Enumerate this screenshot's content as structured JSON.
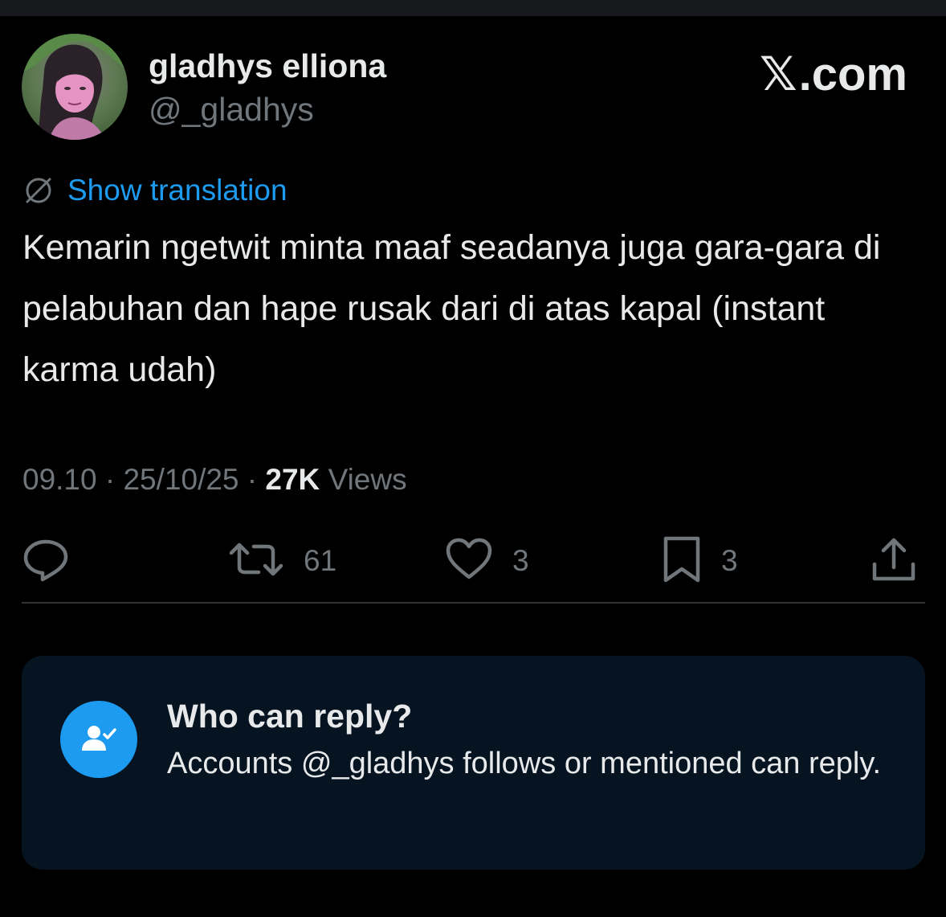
{
  "user": {
    "display_name": "gladhys elliona",
    "handle": "@_gladhys"
  },
  "brand": {
    "x_glyph": "𝕏",
    "suffix": ".com"
  },
  "translation": {
    "label": "Show translation",
    "icon": "globe-icon"
  },
  "tweet": {
    "text": "Kemarin ngetwit minta maaf seadanya juga gara-gara di pelabuhan dan hape rusak dari di atas kapal (instant karma udah)"
  },
  "meta": {
    "time": "09.10",
    "separator": "·",
    "date": "25/10/25",
    "views_count": "27K",
    "views_label": "Views"
  },
  "actions": {
    "reply": {
      "icon": "reply-icon",
      "count": ""
    },
    "repost": {
      "icon": "repost-icon",
      "count": "61"
    },
    "like": {
      "icon": "heart-icon",
      "count": "3"
    },
    "bookmark": {
      "icon": "bookmark-icon",
      "count": "3"
    },
    "share": {
      "icon": "share-icon"
    }
  },
  "reply_settings": {
    "icon": "user-check-icon",
    "title": "Who can reply?",
    "description": "Accounts @_gladhys follows or mentioned can reply."
  },
  "colors": {
    "background": "#000000",
    "text_primary": "#e7e9ea",
    "text_secondary": "#71767b",
    "accent": "#1d9bf0",
    "card_background": "#061421",
    "divider": "#2f3336"
  }
}
